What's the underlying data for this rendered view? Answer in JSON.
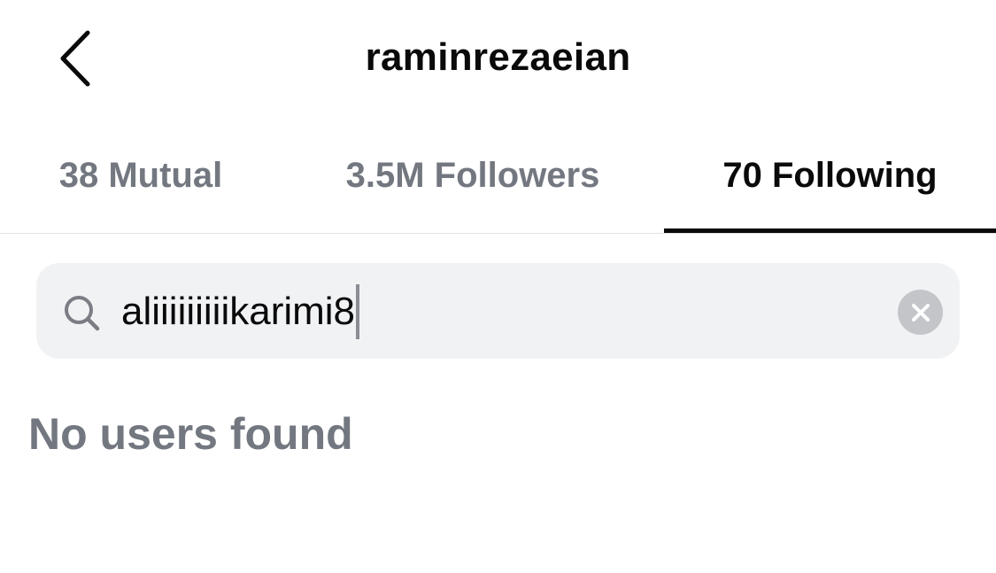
{
  "header": {
    "back_icon": "chevron-left-icon",
    "title": "raminrezaeian"
  },
  "tabs": [
    {
      "label": "38 Mutual",
      "active": false
    },
    {
      "label": "3.5M Followers",
      "active": false
    },
    {
      "label": "70 Following",
      "active": true
    }
  ],
  "search": {
    "icon": "search-icon",
    "value": "aliiiiiiiiikarimi8",
    "clear_icon": "clear-icon"
  },
  "results": {
    "empty_message": "No users found"
  },
  "colors": {
    "primary_text": "#0a0a0a",
    "secondary_text": "#737780",
    "search_bg": "#f1f2f4",
    "clear_button_bg": "#c3c5c9"
  }
}
